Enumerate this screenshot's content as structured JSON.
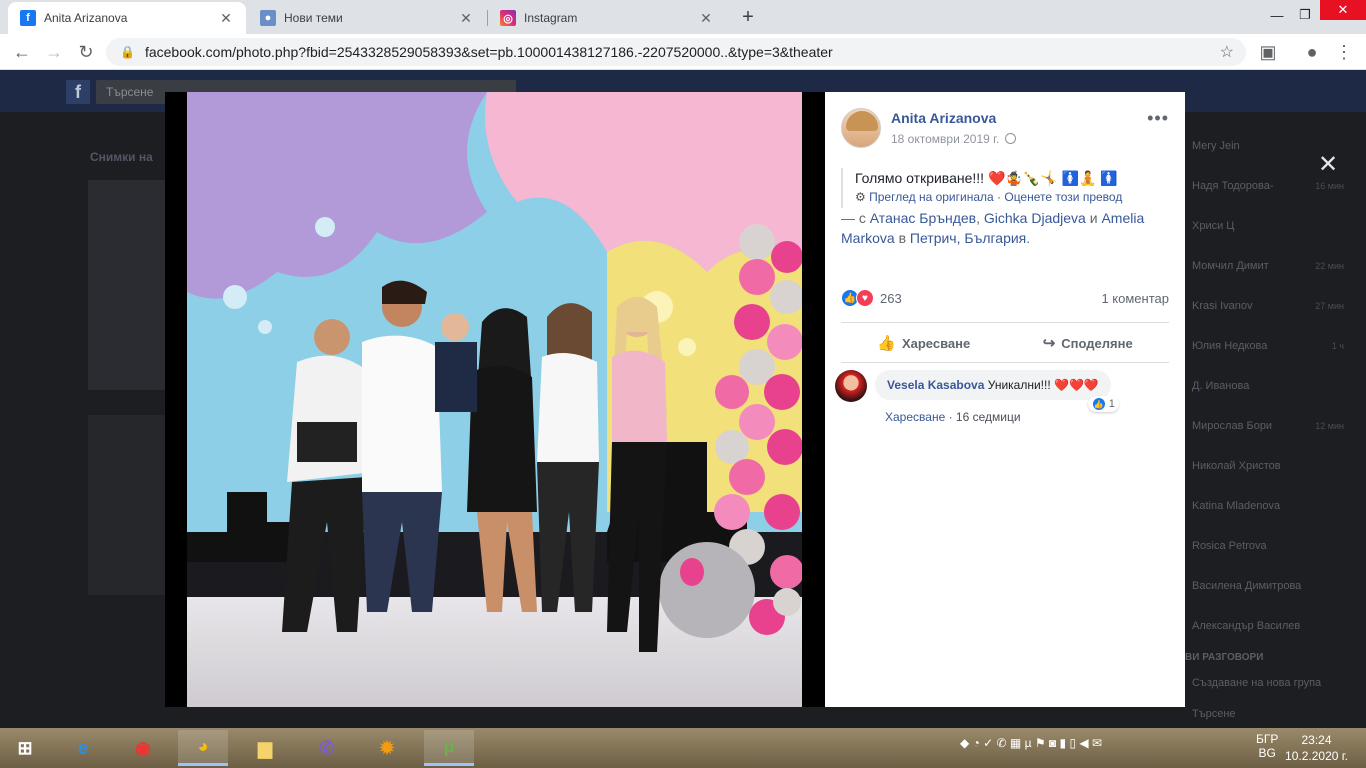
{
  "browser": {
    "tabs": [
      {
        "title": "Anita Arizanova",
        "icon": "facebook-icon",
        "active": true
      },
      {
        "title": "Нови теми",
        "icon": "forum-icon",
        "active": false
      },
      {
        "title": "Instagram",
        "icon": "instagram-icon",
        "active": false
      }
    ],
    "url": "facebook.com/photo.php?fbid=2543328529058393&set=pb.100001438127186.-2207520000..&type=3&theater"
  },
  "facebook_bg": {
    "search_placeholder": "Търсене",
    "section_label": "Снимки на",
    "chat_contacts": [
      {
        "name": "Mery Jein",
        "time": ""
      },
      {
        "name": "Надя Тодорова-",
        "time": "16 мин"
      },
      {
        "name": "Хриси Ц",
        "time": ""
      },
      {
        "name": "Момчил Димит",
        "time": "22 мин"
      },
      {
        "name": "Krasi Ivanov",
        "time": "27 мин"
      },
      {
        "name": "Юлия Недкова",
        "time": "1 ч"
      },
      {
        "name": "Д. Иванова",
        "time": ""
      },
      {
        "name": "Мирослав Бори",
        "time": "12 мин"
      },
      {
        "name": "Николай Христов",
        "time": ""
      },
      {
        "name": "Katina Mladenova",
        "time": ""
      },
      {
        "name": "Rosica Petrova",
        "time": ""
      },
      {
        "name": "Василена Димитрова",
        "time": ""
      },
      {
        "name": "Александър Василев",
        "time": ""
      }
    ],
    "group_heading": "ВИ РАЗГОВОРИ",
    "create_group": "Създаване на нова група",
    "chat_search": "Търсене"
  },
  "post": {
    "author": "Anita Arizanova",
    "date": "18 октомври 2019 г.",
    "text": "Голямо откриване!!! ❤️🤹🍾🤸 🚺🧘 🚺",
    "see_original": "Преглед на оригинала",
    "rate_translation": "Оценете този превод",
    "with_prefix": "— с",
    "tagged": [
      "Атанас Бръндев",
      "Gichka Djadjeva",
      "Amelia Markova"
    ],
    "and_word": "и",
    "in_word": "в",
    "location": "Петрич, България",
    "reaction_count": "263",
    "comments_count": "1 коментар",
    "like_label": "Харесване",
    "share_label": "Споделяне"
  },
  "comment": {
    "author": "Vesela Kasabova",
    "text": "Уникални!!! ❤️❤️❤️",
    "like": "Харесване",
    "time": "16 седмици",
    "reactions": "1"
  },
  "taskbar": {
    "lang": "БГР",
    "lang2": "BG",
    "time": "23:24",
    "date": "10.2.2020 г."
  }
}
